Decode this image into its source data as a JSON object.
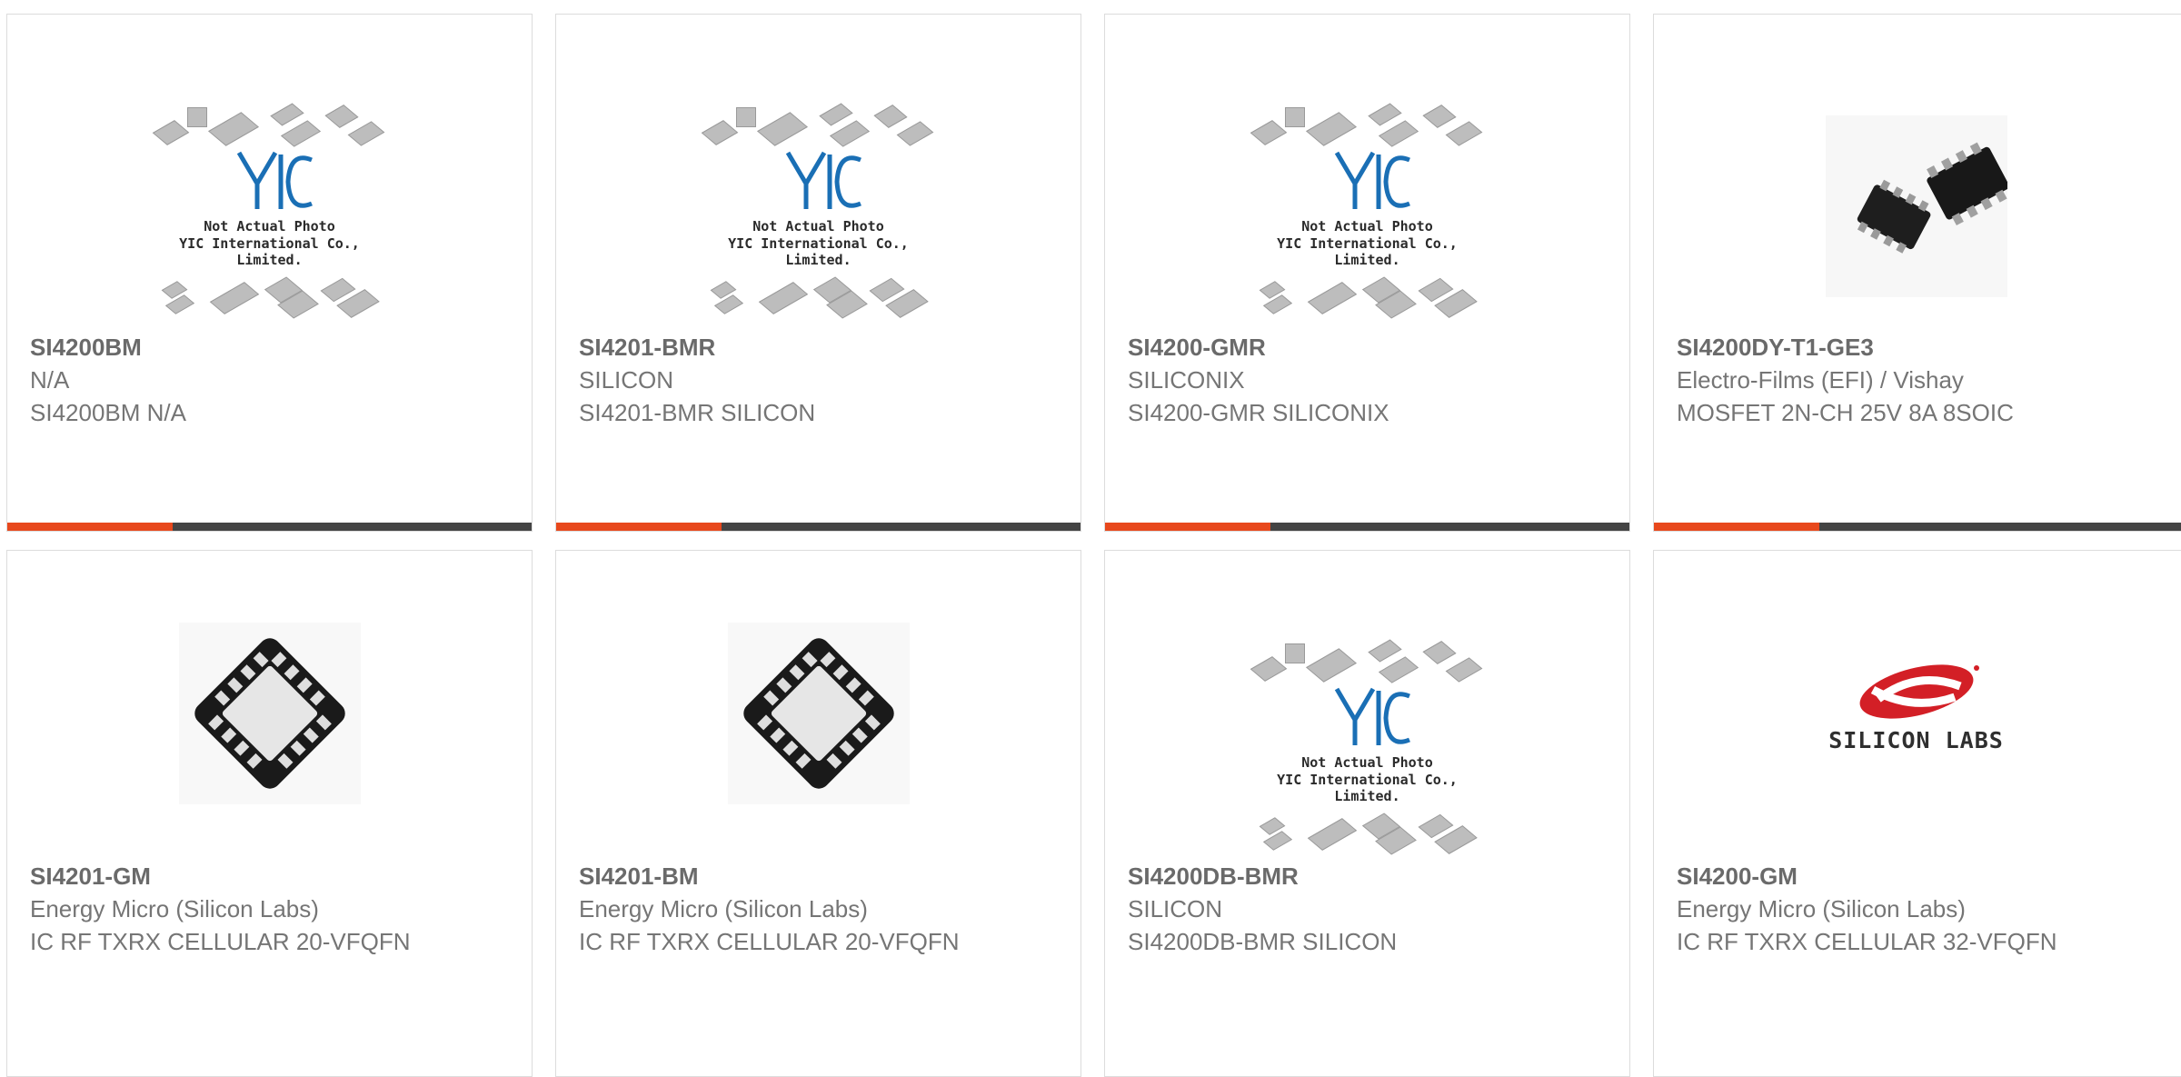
{
  "colors": {
    "accent": "#e8481c",
    "bar": "#444444",
    "border": "#dcdcdc"
  },
  "placeholder": {
    "caption_line1": "Not Actual Photo",
    "caption_line2": "YIC International Co., Limited."
  },
  "products": [
    {
      "part": "SI4200BM",
      "manufacturer": "N/A",
      "description": "SI4200BM N/A",
      "image": "placeholder"
    },
    {
      "part": "SI4201-BMR",
      "manufacturer": "SILICON",
      "description": "SI4201-BMR SILICON",
      "image": "placeholder"
    },
    {
      "part": "SI4200-GMR",
      "manufacturer": "SILICONIX",
      "description": "SI4200-GMR SILICONIX",
      "image": "placeholder"
    },
    {
      "part": "SI4200DY-T1-GE3",
      "manufacturer": "Electro-Films (EFI) / Vishay",
      "description": "MOSFET 2N-CH 25V 8A 8SOIC",
      "image": "soic-photo"
    },
    {
      "part": "SI4201-GM",
      "manufacturer": "Energy Micro (Silicon Labs)",
      "description": "IC RF TXRX CELLULAR 20-VFQFN",
      "image": "qfn-photo"
    },
    {
      "part": "SI4201-BM",
      "manufacturer": "Energy Micro (Silicon Labs)",
      "description": "IC RF TXRX CELLULAR 20-VFQFN",
      "image": "qfn-photo"
    },
    {
      "part": "SI4200DB-BMR",
      "manufacturer": "SILICON",
      "description": "SI4200DB-BMR SILICON",
      "image": "placeholder"
    },
    {
      "part": "SI4200-GM",
      "manufacturer": "Energy Micro (Silicon Labs)",
      "description": "IC RF TXRX CELLULAR 32-VFQFN",
      "image": "silicon-labs-logo",
      "logo_text": "SILICON LABS"
    }
  ]
}
